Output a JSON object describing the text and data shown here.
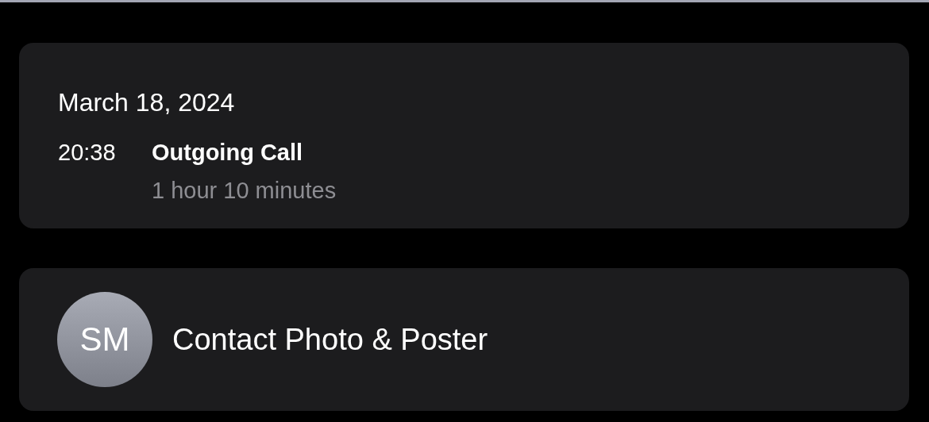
{
  "call_card": {
    "date": "March 18, 2024",
    "entries": [
      {
        "time": "20:38",
        "type": "Outgoing Call",
        "duration": "1 hour 10 minutes"
      }
    ]
  },
  "contact_card": {
    "avatar_initials": "SM",
    "label": "Contact Photo & Poster"
  }
}
